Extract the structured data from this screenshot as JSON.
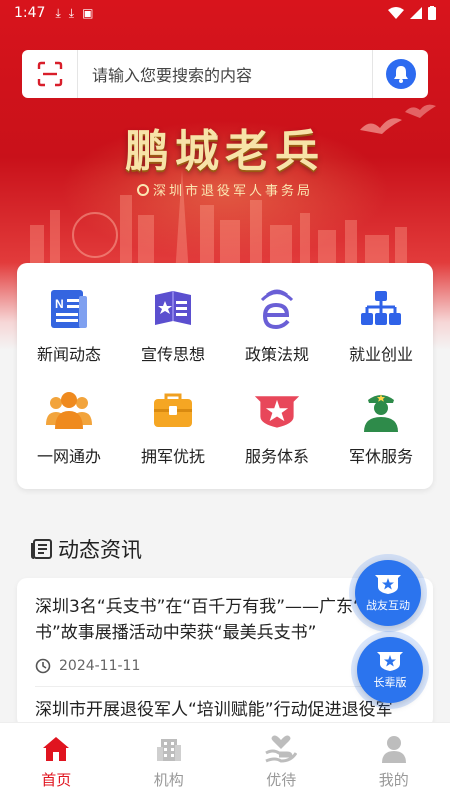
{
  "status_bar": {
    "time": "1:47"
  },
  "search": {
    "placeholder": "请输入您要搜索的内容"
  },
  "banner": {
    "title": "鹏城老兵",
    "subtitle": "深圳市退役军人事务局"
  },
  "grid": [
    {
      "label": "新闻动态",
      "icon": "newspaper-icon"
    },
    {
      "label": "宣传思想",
      "icon": "book-star-icon"
    },
    {
      "label": "政策法规",
      "icon": "e-policy-icon"
    },
    {
      "label": "就业创业",
      "icon": "org-chart-icon"
    },
    {
      "label": "一网通办",
      "icon": "people-group-icon"
    },
    {
      "label": "拥军优抚",
      "icon": "toolbox-icon"
    },
    {
      "label": "服务体系",
      "icon": "star-badge-icon"
    },
    {
      "label": "军休服务",
      "icon": "soldier-icon"
    }
  ],
  "news_section": {
    "title": "动态资讯"
  },
  "news": [
    {
      "headline": "深圳3名“兵支书”在“百千万有我”——广东“兵支书”故事展播活动中荣获“最美兵支书”",
      "date": "2024-11-11"
    },
    {
      "headline": "深圳市开展退役军人“培训赋能”行动促进退役军"
    }
  ],
  "fabs": {
    "interact": "战友互动",
    "elder": "长辈版"
  },
  "tabs": [
    {
      "label": "首页",
      "icon": "home-icon"
    },
    {
      "label": "机构",
      "icon": "building-icon"
    },
    {
      "label": "优待",
      "icon": "heart-hand-icon"
    },
    {
      "label": "我的",
      "icon": "user-icon"
    }
  ],
  "colors": {
    "brand_red": "#e0141f",
    "fab_blue": "#2b74ee",
    "icon_blue": "#2f62e8"
  }
}
